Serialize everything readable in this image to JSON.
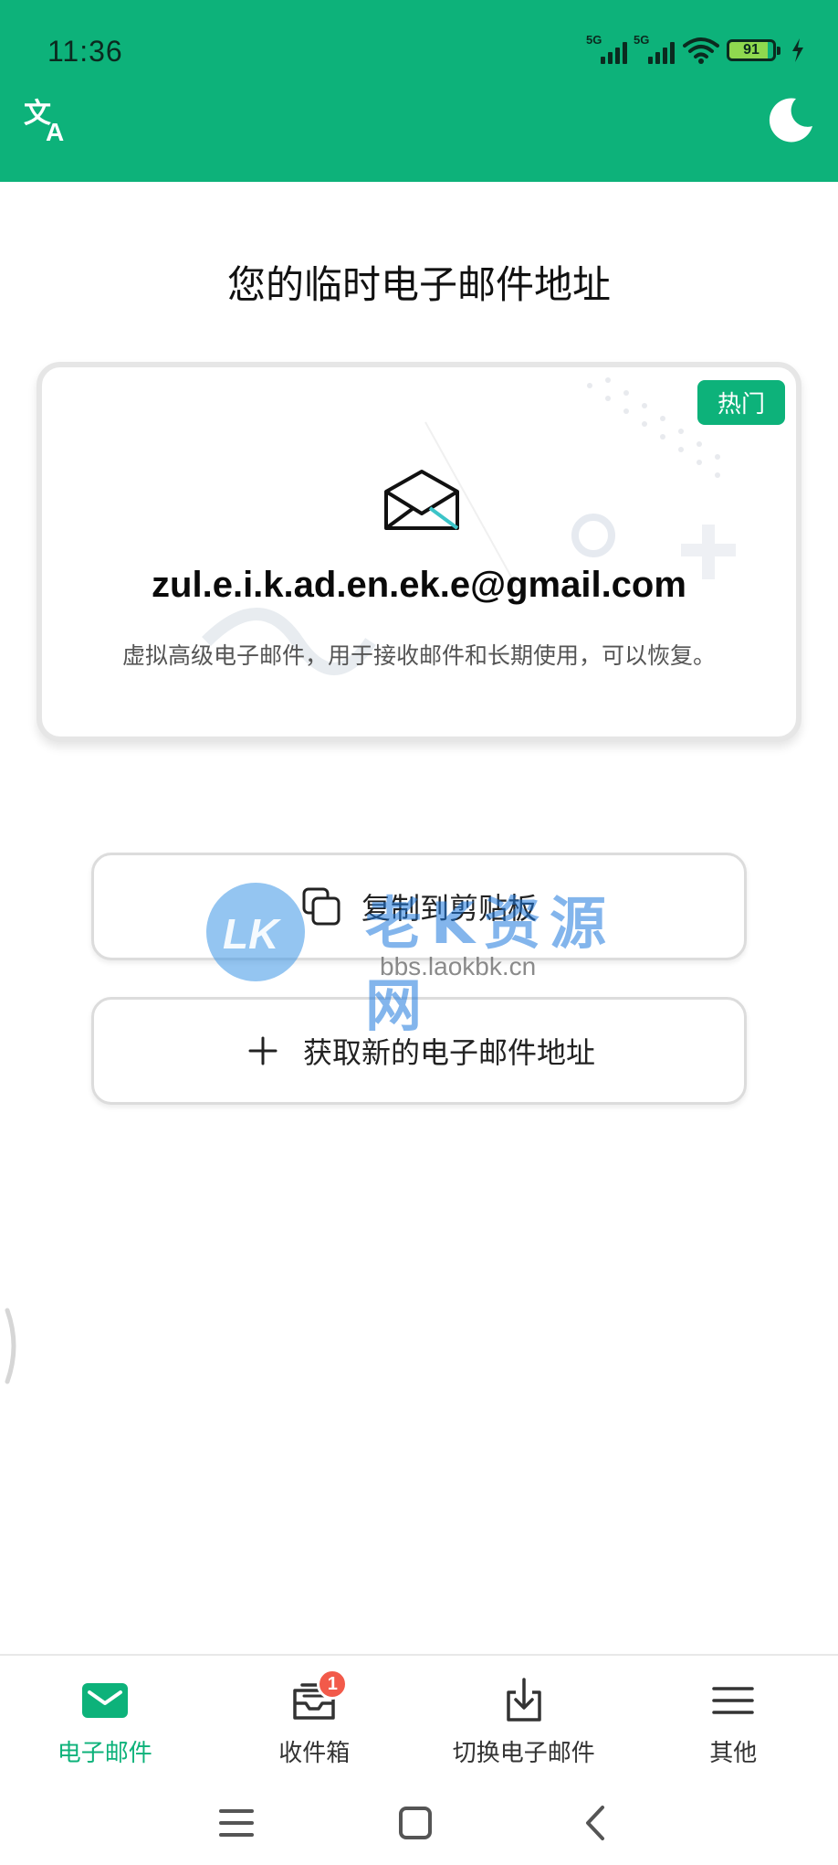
{
  "status_bar": {
    "time": "11:36",
    "network_1": "5G",
    "network_2": "5G",
    "battery": "91"
  },
  "header": {
    "translate_icon": "translate-icon",
    "theme_icon": "moon-icon",
    "bg_color": "#0db27a"
  },
  "main": {
    "title": "您的临时电子邮件地址",
    "card": {
      "badge": "热门",
      "email": "zul.e.i.k.ad.en.ek.e@gmail.com",
      "description": "虚拟高级电子邮件，用于接收邮件和长期使用，可以恢复。"
    },
    "copy_button_label": "复制到剪贴板",
    "new_button_label": "获取新的电子邮件地址"
  },
  "watermark": {
    "text": "老K资源网",
    "url": "bbs.laokbk.cn"
  },
  "bottom_nav": {
    "items": [
      {
        "label": "电子邮件",
        "icon": "mail-icon",
        "active": true
      },
      {
        "label": "收件箱",
        "icon": "inbox-icon",
        "badge": "1"
      },
      {
        "label": "切换电子邮件",
        "icon": "download-icon"
      },
      {
        "label": "其他",
        "icon": "menu-icon"
      }
    ]
  },
  "colors": {
    "accent": "#0db27a",
    "badge": "#f25a4a"
  }
}
